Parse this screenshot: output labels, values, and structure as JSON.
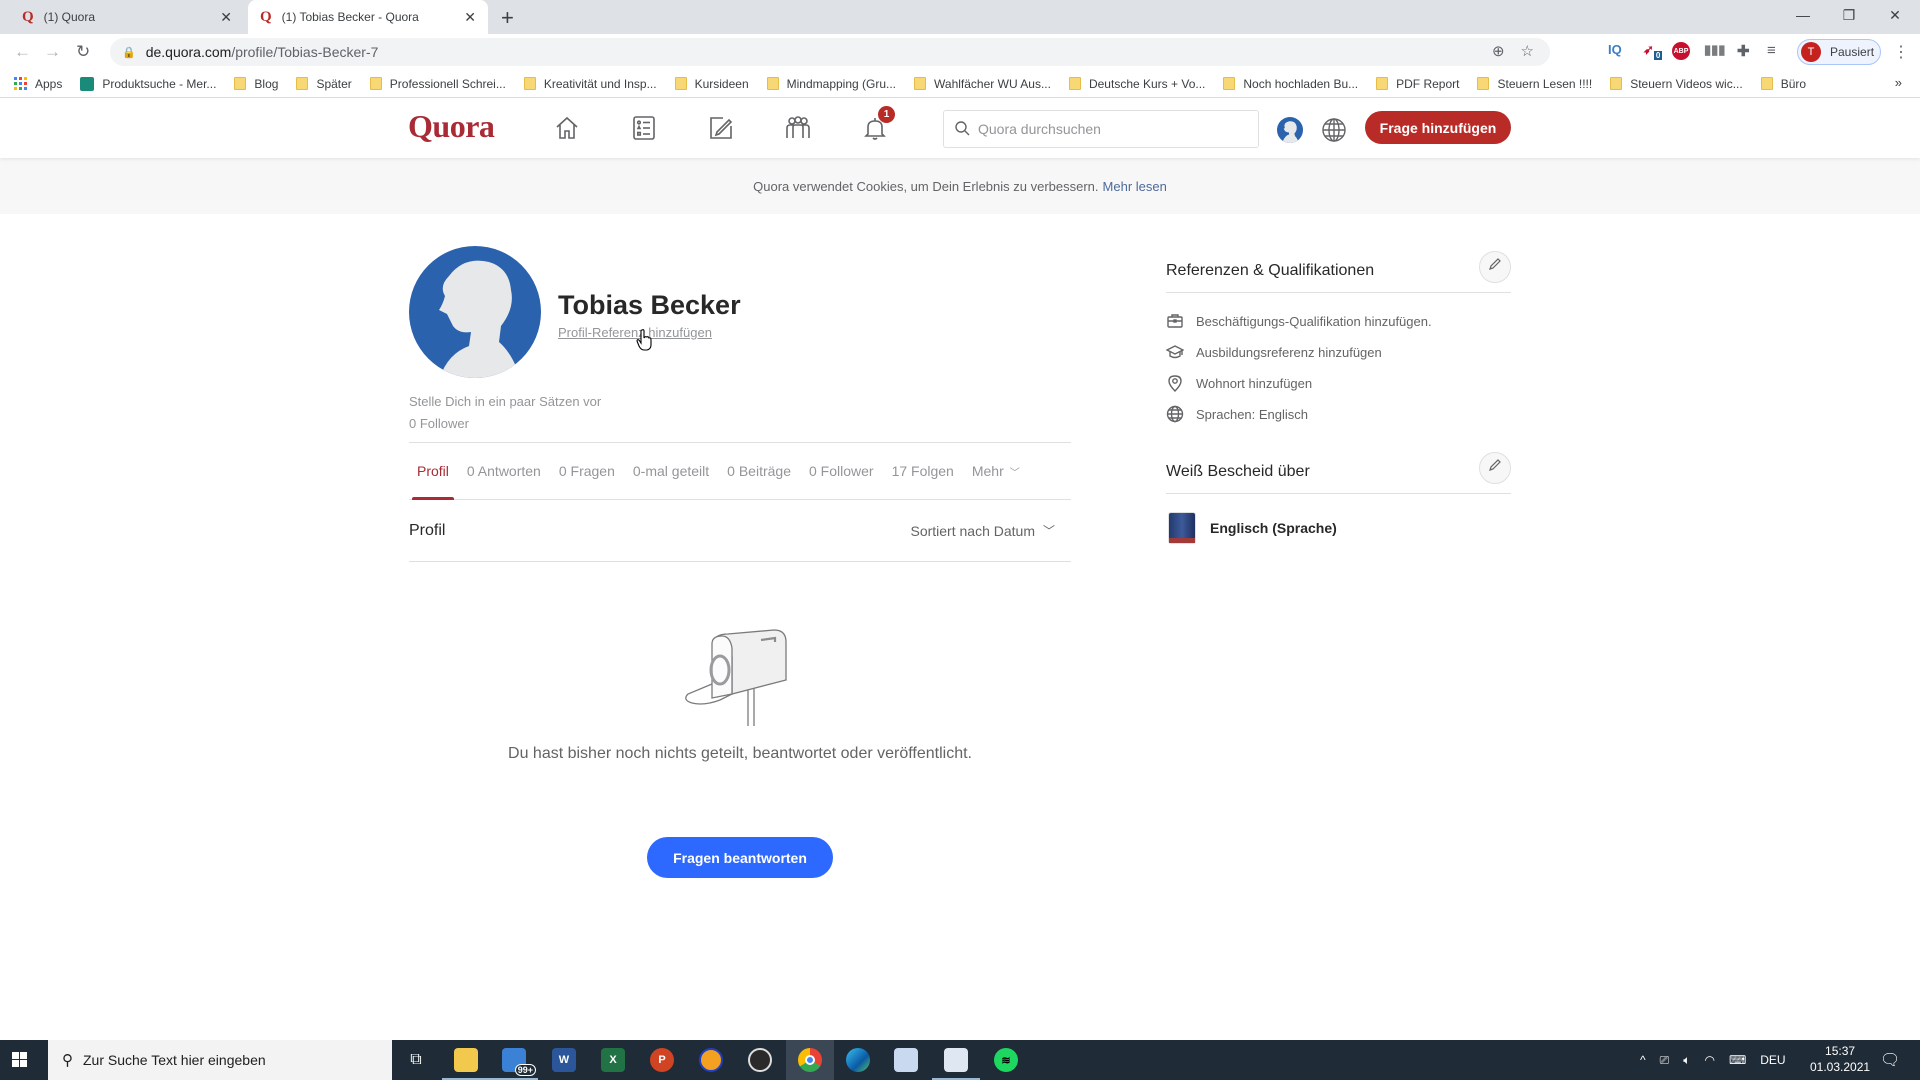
{
  "browser": {
    "tabs": [
      {
        "title": "(1) Quora",
        "favicon": "Q",
        "active": false
      },
      {
        "title": "(1) Tobias Becker - Quora",
        "favicon": "Q",
        "active": true
      }
    ],
    "new_tab_label": "+",
    "url_host": "de.quora.com",
    "url_path": "/profile/Tobias-Becker-7",
    "profile_initial": "T",
    "profile_status": "Pausiert",
    "extensions": [
      {
        "name": "iq-extension-icon",
        "label": "IQ"
      },
      {
        "name": "bird-extension-icon",
        "label": "0"
      },
      {
        "name": "adblock-plus-icon",
        "label": "ABP"
      }
    ],
    "bookmarks": [
      {
        "label": "Apps",
        "type": "apps"
      },
      {
        "label": "Produktsuche - Mer...",
        "type": "site"
      },
      {
        "label": "Blog",
        "type": "folder"
      },
      {
        "label": "Später",
        "type": "folder"
      },
      {
        "label": "Professionell Schrei...",
        "type": "folder"
      },
      {
        "label": "Kreativität und Insp...",
        "type": "folder"
      },
      {
        "label": "Kursideen",
        "type": "folder"
      },
      {
        "label": "Mindmapping  (Gru...",
        "type": "folder"
      },
      {
        "label": "Wahlfächer WU Aus...",
        "type": "folder"
      },
      {
        "label": "Deutsche Kurs + Vo...",
        "type": "folder"
      },
      {
        "label": "Noch hochladen Bu...",
        "type": "folder"
      },
      {
        "label": "PDF Report",
        "type": "folder"
      },
      {
        "label": "Steuern Lesen !!!!",
        "type": "folder"
      },
      {
        "label": "Steuern Videos wic...",
        "type": "folder"
      },
      {
        "label": "Büro",
        "type": "folder"
      }
    ],
    "bookmarks_overflow": "»"
  },
  "quora": {
    "logo": "Quora",
    "notification_count": "1",
    "search_placeholder": "Quora durchsuchen",
    "add_question_label": "Frage hinzufügen",
    "brand_color": "#b92b27",
    "cookie_text": "Quora verwendet Cookies, um Dein Erlebnis zu verbessern.",
    "cookie_link": "Mehr lesen"
  },
  "profile": {
    "name": "Tobias Becker",
    "add_credential_link": "Profil-Referenz hinzufügen",
    "bio_placeholder": "Stelle Dich in ein paar Sätzen vor",
    "followers": "0 Follower",
    "tabs": [
      {
        "label": "Profil",
        "active": true
      },
      {
        "label": "0 Antworten"
      },
      {
        "label": "0 Fragen"
      },
      {
        "label": "0-mal geteilt"
      },
      {
        "label": "0 Beiträge"
      },
      {
        "label": "0 Follower"
      },
      {
        "label": "17 Folgen"
      },
      {
        "label": "Mehr"
      }
    ],
    "section_title": "Profil",
    "sort_label": "Sortiert nach Datum",
    "empty_message": "Du hast bisher noch nichts geteilt, beantwortet oder veröffentlicht.",
    "answer_button": "Fragen beantworten"
  },
  "sidebar": {
    "credentials_title": "Referenzen & Qualifikationen",
    "credentials": [
      {
        "icon": "briefcase",
        "label": "Beschäftigungs-Qualifikation hinzufügen."
      },
      {
        "icon": "graduation-cap",
        "label": "Ausbildungsreferenz hinzufügen"
      },
      {
        "icon": "location-pin",
        "label": "Wohnort hinzufügen"
      },
      {
        "icon": "globe",
        "label": "Sprachen: Englisch"
      }
    ],
    "knows_about_title": "Weiß Bescheid über",
    "topics": [
      {
        "label": "Englisch (Sprache)"
      }
    ]
  },
  "taskbar": {
    "search_placeholder": "Zur Suche Text hier eingeben",
    "mail_badge": "99+",
    "language": "DEU",
    "time": "15:37",
    "date": "01.03.2021"
  }
}
